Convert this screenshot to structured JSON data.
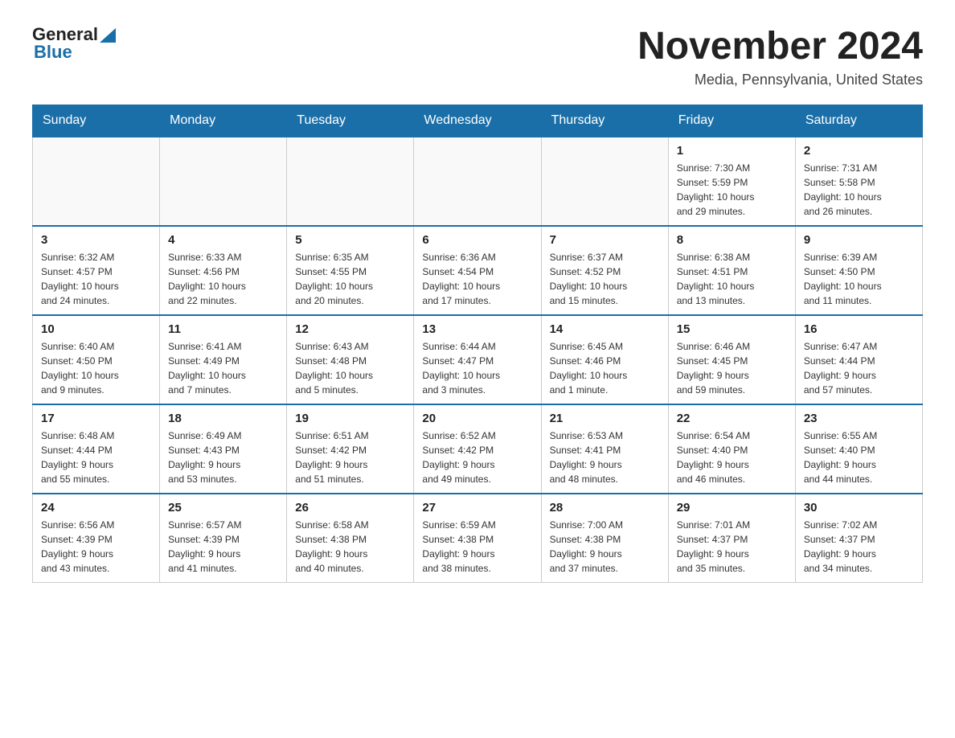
{
  "header": {
    "logo_general": "General",
    "logo_blue": "Blue",
    "month_title": "November 2024",
    "location": "Media, Pennsylvania, United States"
  },
  "weekdays": [
    "Sunday",
    "Monday",
    "Tuesday",
    "Wednesday",
    "Thursday",
    "Friday",
    "Saturday"
  ],
  "weeks": [
    [
      {
        "day": "",
        "info": ""
      },
      {
        "day": "",
        "info": ""
      },
      {
        "day": "",
        "info": ""
      },
      {
        "day": "",
        "info": ""
      },
      {
        "day": "",
        "info": ""
      },
      {
        "day": "1",
        "info": "Sunrise: 7:30 AM\nSunset: 5:59 PM\nDaylight: 10 hours\nand 29 minutes."
      },
      {
        "day": "2",
        "info": "Sunrise: 7:31 AM\nSunset: 5:58 PM\nDaylight: 10 hours\nand 26 minutes."
      }
    ],
    [
      {
        "day": "3",
        "info": "Sunrise: 6:32 AM\nSunset: 4:57 PM\nDaylight: 10 hours\nand 24 minutes."
      },
      {
        "day": "4",
        "info": "Sunrise: 6:33 AM\nSunset: 4:56 PM\nDaylight: 10 hours\nand 22 minutes."
      },
      {
        "day": "5",
        "info": "Sunrise: 6:35 AM\nSunset: 4:55 PM\nDaylight: 10 hours\nand 20 minutes."
      },
      {
        "day": "6",
        "info": "Sunrise: 6:36 AM\nSunset: 4:54 PM\nDaylight: 10 hours\nand 17 minutes."
      },
      {
        "day": "7",
        "info": "Sunrise: 6:37 AM\nSunset: 4:52 PM\nDaylight: 10 hours\nand 15 minutes."
      },
      {
        "day": "8",
        "info": "Sunrise: 6:38 AM\nSunset: 4:51 PM\nDaylight: 10 hours\nand 13 minutes."
      },
      {
        "day": "9",
        "info": "Sunrise: 6:39 AM\nSunset: 4:50 PM\nDaylight: 10 hours\nand 11 minutes."
      }
    ],
    [
      {
        "day": "10",
        "info": "Sunrise: 6:40 AM\nSunset: 4:50 PM\nDaylight: 10 hours\nand 9 minutes."
      },
      {
        "day": "11",
        "info": "Sunrise: 6:41 AM\nSunset: 4:49 PM\nDaylight: 10 hours\nand 7 minutes."
      },
      {
        "day": "12",
        "info": "Sunrise: 6:43 AM\nSunset: 4:48 PM\nDaylight: 10 hours\nand 5 minutes."
      },
      {
        "day": "13",
        "info": "Sunrise: 6:44 AM\nSunset: 4:47 PM\nDaylight: 10 hours\nand 3 minutes."
      },
      {
        "day": "14",
        "info": "Sunrise: 6:45 AM\nSunset: 4:46 PM\nDaylight: 10 hours\nand 1 minute."
      },
      {
        "day": "15",
        "info": "Sunrise: 6:46 AM\nSunset: 4:45 PM\nDaylight: 9 hours\nand 59 minutes."
      },
      {
        "day": "16",
        "info": "Sunrise: 6:47 AM\nSunset: 4:44 PM\nDaylight: 9 hours\nand 57 minutes."
      }
    ],
    [
      {
        "day": "17",
        "info": "Sunrise: 6:48 AM\nSunset: 4:44 PM\nDaylight: 9 hours\nand 55 minutes."
      },
      {
        "day": "18",
        "info": "Sunrise: 6:49 AM\nSunset: 4:43 PM\nDaylight: 9 hours\nand 53 minutes."
      },
      {
        "day": "19",
        "info": "Sunrise: 6:51 AM\nSunset: 4:42 PM\nDaylight: 9 hours\nand 51 minutes."
      },
      {
        "day": "20",
        "info": "Sunrise: 6:52 AM\nSunset: 4:42 PM\nDaylight: 9 hours\nand 49 minutes."
      },
      {
        "day": "21",
        "info": "Sunrise: 6:53 AM\nSunset: 4:41 PM\nDaylight: 9 hours\nand 48 minutes."
      },
      {
        "day": "22",
        "info": "Sunrise: 6:54 AM\nSunset: 4:40 PM\nDaylight: 9 hours\nand 46 minutes."
      },
      {
        "day": "23",
        "info": "Sunrise: 6:55 AM\nSunset: 4:40 PM\nDaylight: 9 hours\nand 44 minutes."
      }
    ],
    [
      {
        "day": "24",
        "info": "Sunrise: 6:56 AM\nSunset: 4:39 PM\nDaylight: 9 hours\nand 43 minutes."
      },
      {
        "day": "25",
        "info": "Sunrise: 6:57 AM\nSunset: 4:39 PM\nDaylight: 9 hours\nand 41 minutes."
      },
      {
        "day": "26",
        "info": "Sunrise: 6:58 AM\nSunset: 4:38 PM\nDaylight: 9 hours\nand 40 minutes."
      },
      {
        "day": "27",
        "info": "Sunrise: 6:59 AM\nSunset: 4:38 PM\nDaylight: 9 hours\nand 38 minutes."
      },
      {
        "day": "28",
        "info": "Sunrise: 7:00 AM\nSunset: 4:38 PM\nDaylight: 9 hours\nand 37 minutes."
      },
      {
        "day": "29",
        "info": "Sunrise: 7:01 AM\nSunset: 4:37 PM\nDaylight: 9 hours\nand 35 minutes."
      },
      {
        "day": "30",
        "info": "Sunrise: 7:02 AM\nSunset: 4:37 PM\nDaylight: 9 hours\nand 34 minutes."
      }
    ]
  ]
}
